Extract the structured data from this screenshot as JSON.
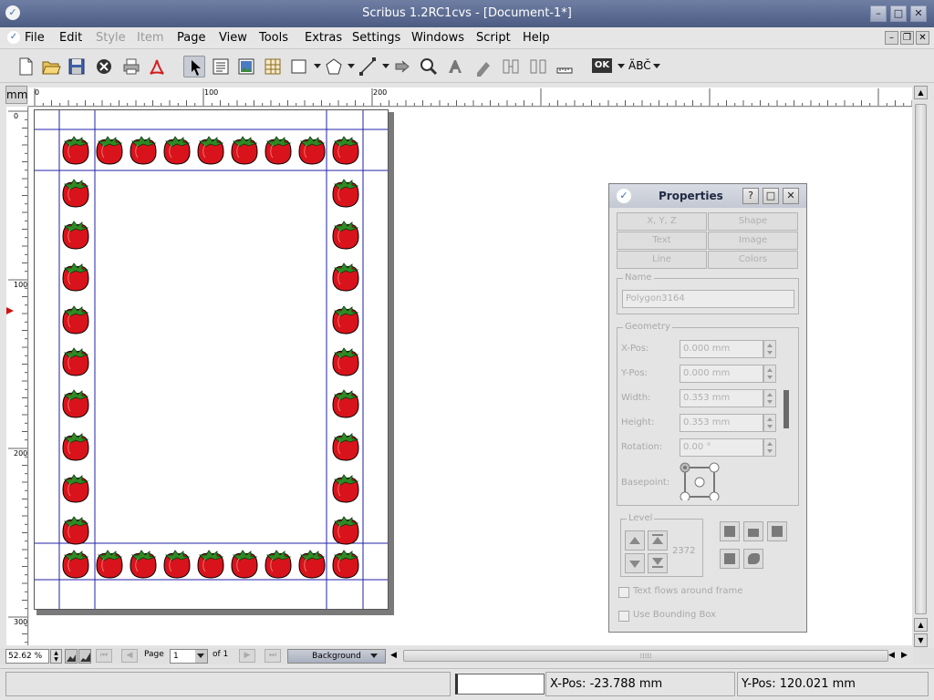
{
  "window": {
    "title": "Scribus 1.2RC1cvs - [Document-1*]",
    "buttons": {
      "minimize": "–",
      "maximize": "□",
      "close": "✕"
    }
  },
  "menu": {
    "items": [
      "File",
      "Edit",
      "Style",
      "Item",
      "Page",
      "View",
      "Tools",
      "Extras",
      "Settings",
      "Windows",
      "Script",
      "Help"
    ],
    "disabled": [
      "Style",
      "Item"
    ]
  },
  "toolbar": {
    "icons": [
      "new-icon",
      "open-icon",
      "save-icon",
      "close-doc-icon",
      "print-icon",
      "pdf-icon",
      "select-icon",
      "text-frame-icon",
      "image-frame-icon",
      "table-icon",
      "shape-icon",
      "polygon-icon",
      "line-icon",
      "rotate-icon",
      "zoom-icon",
      "edit-text-icon",
      "link-frames-icon",
      "unlink-frames-icon",
      "measure-icon",
      "preflight-ok-icon",
      "spellcheck-icon"
    ],
    "preflight_label": "OK",
    "spell_label": "ÄBČ"
  },
  "ruler": {
    "unit": "mm",
    "h_labels": [
      "0",
      "100",
      "200"
    ],
    "v_labels": [
      "0",
      "100",
      "200",
      "300"
    ]
  },
  "properties": {
    "title": "Properties",
    "help": "?",
    "tabs": [
      "X, Y, Z",
      "Shape",
      "Text",
      "Image",
      "Line",
      "Colors"
    ],
    "name_label": "Name",
    "name_value": "Polygon3164",
    "geometry_label": "Geometry",
    "xpos_label": "X-Pos:",
    "xpos_value": "0.000 mm",
    "ypos_label": "Y-Pos:",
    "ypos_value": "0.000 mm",
    "width_label": "Width:",
    "width_value": "0.353 mm",
    "height_label": "Height:",
    "height_value": "0.353 mm",
    "rotation_label": "Rotation:",
    "rotation_value": "0.00 °",
    "basepoint_label": "Basepoint:",
    "level_label": "Level",
    "level_value": "2372",
    "text_flows_label": "Text flows around frame",
    "bounding_box_label": "Use Bounding Box"
  },
  "nav": {
    "zoom": "52.62 %",
    "page_label": "Page",
    "page_value": "1",
    "page_of": "of 1",
    "layer": "Background"
  },
  "status": {
    "xpos_label": "X-Pos:",
    "xpos_value": "-23.788 mm",
    "ypos_label": "Y-Pos:",
    "ypos_value": "120.021 mm"
  },
  "colors": {
    "titlebar": "#5b6b92",
    "guides": "#2222aa",
    "tomato": "#d9131b",
    "leaf": "#2f8a24"
  }
}
